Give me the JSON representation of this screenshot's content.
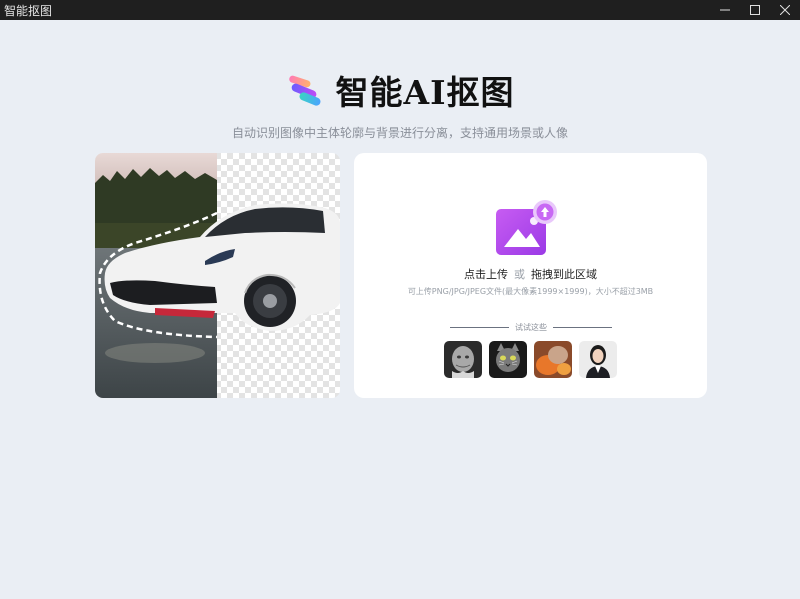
{
  "window": {
    "title": "智能抠图",
    "controls": [
      "minimize",
      "maximize",
      "close"
    ]
  },
  "header": {
    "app_title": "智能AI抠图",
    "subtitle": "自动识别图像中主体轮廓与背景进行分离，支持通用场景或人像"
  },
  "upload": {
    "click_label": "点击上传",
    "or_label": "或",
    "drag_label": "拖拽到此区域",
    "hint": "可上传PNG/JPG/JPEG文件(最大像素1999×1999)，大小不超过3MB",
    "try_label": "试试这些"
  },
  "samples": [
    {
      "name": "sample-elderly-portrait"
    },
    {
      "name": "sample-cat"
    },
    {
      "name": "sample-orange-object"
    },
    {
      "name": "sample-business-woman"
    }
  ],
  "colors": {
    "background": "#eaeef4",
    "accent_purple": "#b44df0",
    "titlebar": "#1f1f1f"
  }
}
